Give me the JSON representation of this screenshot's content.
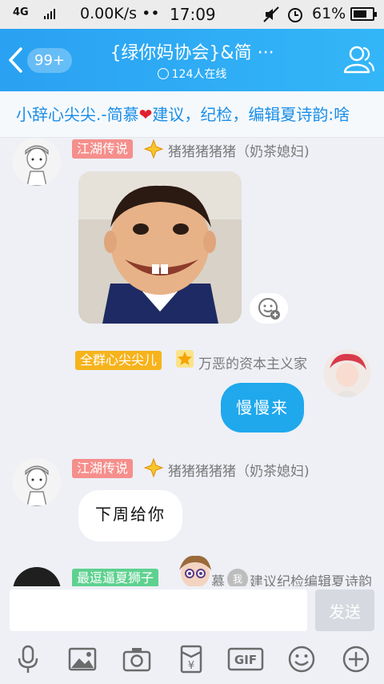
{
  "status_bar": {
    "network_left": "4G",
    "network_small": "4G 2G",
    "speed": "0.00K/s",
    "dots": "••",
    "time": "17:09",
    "battery": "61%"
  },
  "header": {
    "unread": "99+",
    "title": "{绿你妈协会}&简 ···",
    "online": "124人在线"
  },
  "notice": {
    "prefix": "小辞心尖尖.-简慕",
    "suffix": "建议，纪检，编辑夏诗韵:啥"
  },
  "messages": [
    {
      "badge": "江湖传说",
      "nickname": "猪猪猪猪猪（奶茶媳妇)",
      "type": "sticker"
    },
    {
      "badge": "全群心尖尖儿",
      "nickname": "万恶的资本主义家",
      "text": "慢慢来",
      "type": "text",
      "self": true
    },
    {
      "badge": "江湖传说",
      "nickname": "猪猪猪猪猪（奶茶媳妇)",
      "text": "下周给你",
      "type": "text"
    },
    {
      "badge": "最逗逼夏狮子",
      "nickname_a": "慕",
      "nickname_b": "建议纪检编辑夏诗韵",
      "mini_badge": "我",
      "type": "partial"
    }
  ],
  "input": {
    "value": "",
    "send_label": "发送"
  },
  "toolbar": {
    "gif_label": "GIF",
    "red_packet_symbol": "¥"
  },
  "colors": {
    "header": "#2aa1f2",
    "self_bubble": "#1fa8ec",
    "notice_text": "#1a8ee8"
  }
}
